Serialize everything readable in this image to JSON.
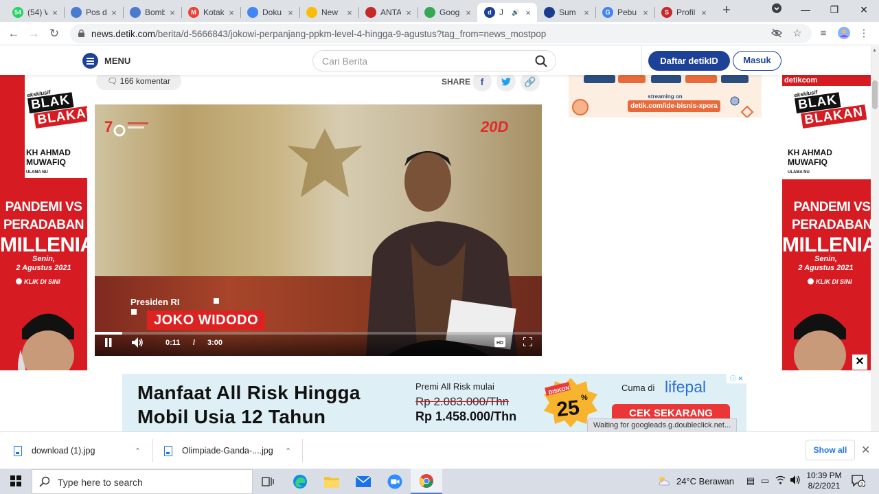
{
  "browser": {
    "tabs": [
      {
        "label": "(54) W",
        "favicon_color": "#25d366",
        "favicon_text": "54",
        "active": false
      },
      {
        "label": "Pos d",
        "favicon_color": "#4a7bd1",
        "favicon_text": "",
        "active": false
      },
      {
        "label": "Bomb",
        "favicon_color": "#4a7bd1",
        "favicon_text": "",
        "active": false
      },
      {
        "label": "Kotak",
        "favicon_color": "#ea4335",
        "favicon_text": "M",
        "active": false
      },
      {
        "label": "Doku",
        "favicon_color": "#4285f4",
        "favicon_text": "",
        "active": false
      },
      {
        "label": "New",
        "favicon_color": "#fbbc05",
        "favicon_text": "",
        "active": false
      },
      {
        "label": "ANTA",
        "favicon_color": "#c62828",
        "favicon_text": "",
        "active": false
      },
      {
        "label": "Goog",
        "favicon_color": "#34a853",
        "favicon_text": "",
        "active": false
      },
      {
        "label": "J",
        "favicon_color": "#1c4197",
        "favicon_text": "d",
        "active": true
      },
      {
        "label": "Sum",
        "favicon_color": "#1c3d8f",
        "favicon_text": "",
        "active": false
      },
      {
        "label": "Pebu",
        "favicon_color": "#4285f4",
        "favicon_text": "G",
        "active": false
      },
      {
        "label": "Profil",
        "favicon_color": "#c62828",
        "favicon_text": "S",
        "active": false
      }
    ],
    "url_host": "news.detik.com",
    "url_path": "/berita/d-5666843/jokowi-perpanjang-ppkm-level-4-hingga-9-agustus?tag_from=news_mostpop",
    "status_text": "Waiting for googleads.g.doubleclick.net..."
  },
  "site": {
    "menu_label": "MENU",
    "search_placeholder": "Cari Berita",
    "register_label": "Daftar detikID",
    "login_label": "Masuk"
  },
  "article": {
    "comments_label": "166 komentar",
    "share_label": "SHARE"
  },
  "video": {
    "badge_label": "20D",
    "caption_role": "Presiden RI",
    "caption_name": "JOKO WIDODO",
    "current_time": "0:11",
    "time_separator": "/",
    "duration": "3:00",
    "progress_fraction": 0.061
  },
  "side_ads": {
    "brand": "detikcom",
    "exclusive": "eksklusif",
    "show_top": "BLAK",
    "show_bottom": "BLAKAN",
    "guest_name_1": "KH AHMAD",
    "guest_name_2": "MUWAFIQ",
    "guest_title": "ULAMA NU",
    "theme_1": "PANDEMI VS",
    "theme_2": "PERADABAN",
    "theme_3": "MILLENIAL",
    "date_1": "Senin,",
    "date_2": "2 Agustus 2021",
    "cta": "KLIK DI SINI"
  },
  "right_ad": {
    "streaming_label": "streaming on",
    "url_label": "detik.com/ide-bisnis-xpora"
  },
  "bottom_ad": {
    "headline_1": "Manfaat All Risk Hingga",
    "headline_2": "Mobil Usia 12 Tahun",
    "premi_label": "Premi All Risk mulai",
    "old_price": "Rp 2.083.000/Thn",
    "new_price": "Rp 1.458.000/Thn",
    "discount_label": "DISKON",
    "discount_value": "25",
    "discount_unit": "%",
    "cuma_label": "Cuma di",
    "brand": "lifepal",
    "cta": "CEK SEKARANG"
  },
  "downloads": {
    "items": [
      {
        "name": "download (1).jpg"
      },
      {
        "name": "Olimpiade-Ganda-....jpg"
      }
    ],
    "show_all": "Show all"
  },
  "taskbar": {
    "search_placeholder": "Type here to search",
    "weather": "24°C  Berawan",
    "time": "10:39 PM",
    "date": "8/2/2021",
    "notification_count": "3"
  }
}
